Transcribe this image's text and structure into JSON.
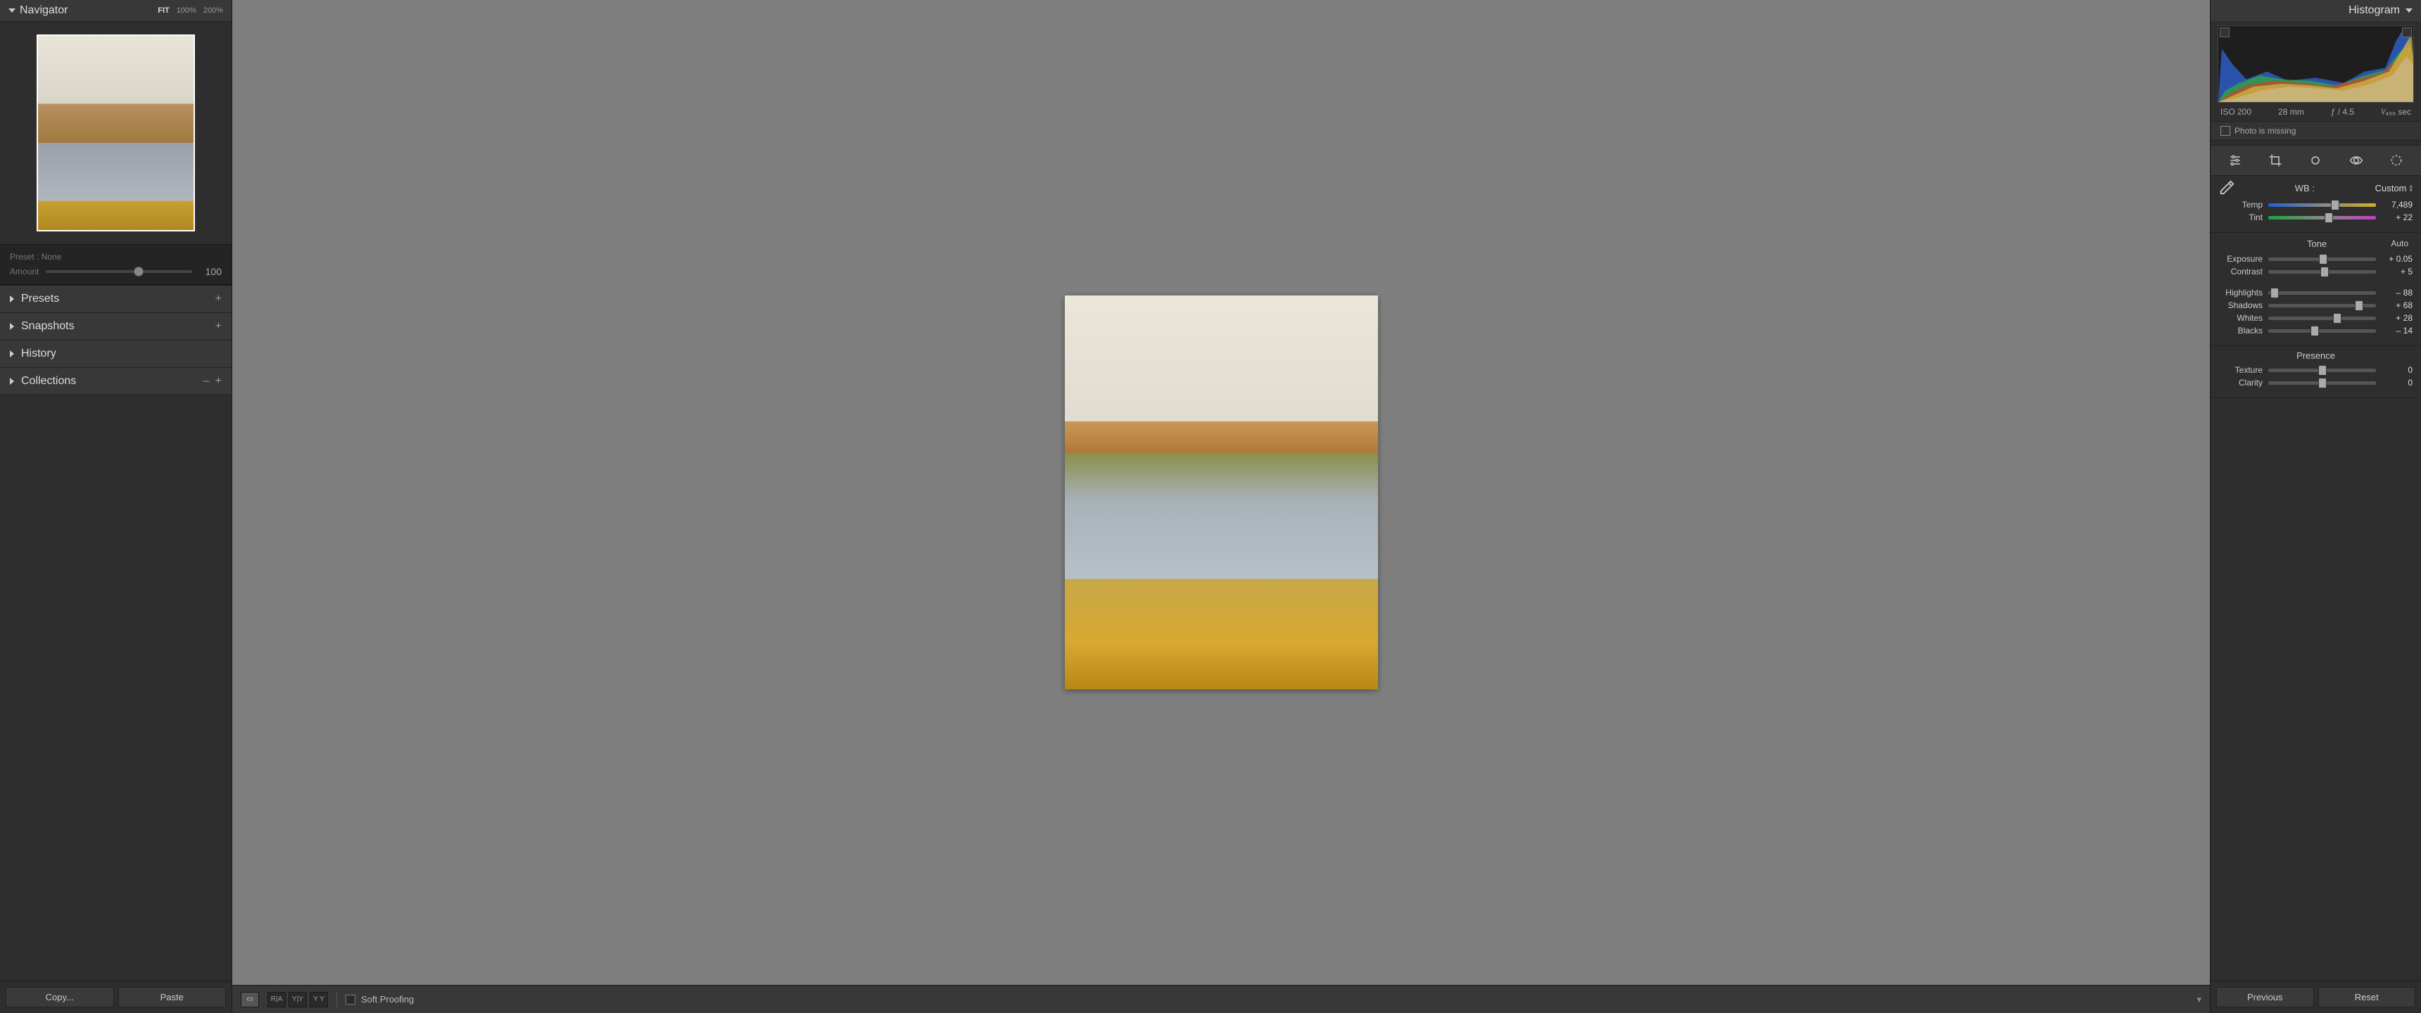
{
  "left": {
    "navigator": "Navigator",
    "zoom": {
      "fit": "FIT",
      "z100": "100%",
      "z200": "200%"
    },
    "preset_label": "Preset : None",
    "amount_label": "Amount",
    "amount_value": "100",
    "sections": {
      "presets": "Presets",
      "snapshots": "Snapshots",
      "history": "History",
      "collections": "Collections"
    },
    "copy": "Copy...",
    "paste": "Paste"
  },
  "center": {
    "soft_proofing": "Soft Proofing",
    "view_labels": {
      "loupe": "▭",
      "ra": "R|A",
      "yy_split": "Y|Y",
      "yy": "Y Y"
    }
  },
  "right": {
    "histogram": "Histogram",
    "exif": {
      "iso": "ISO 200",
      "focal": "28 mm",
      "aperture": "ƒ / 4.5",
      "shutter": "¹⁄₄₀₀ sec"
    },
    "missing": "Photo is missing",
    "wb": {
      "label": "WB :",
      "mode": "Custom",
      "temp_label": "Temp",
      "temp_val": "7,489",
      "tint_label": "Tint",
      "tint_val": "+ 22"
    },
    "tone": {
      "title": "Tone",
      "auto": "Auto",
      "exposure": "Exposure",
      "exposure_v": "+ 0.05",
      "contrast": "Contrast",
      "contrast_v": "+ 5",
      "highlights": "Highlights",
      "highlights_v": "– 88",
      "shadows": "Shadows",
      "shadows_v": "+ 68",
      "whites": "Whites",
      "whites_v": "+ 28",
      "blacks": "Blacks",
      "blacks_v": "– 14"
    },
    "presence": {
      "title": "Presence",
      "texture": "Texture",
      "texture_v": "0",
      "clarity": "Clarity",
      "clarity_v": "0"
    },
    "previous": "Previous",
    "reset": "Reset"
  }
}
